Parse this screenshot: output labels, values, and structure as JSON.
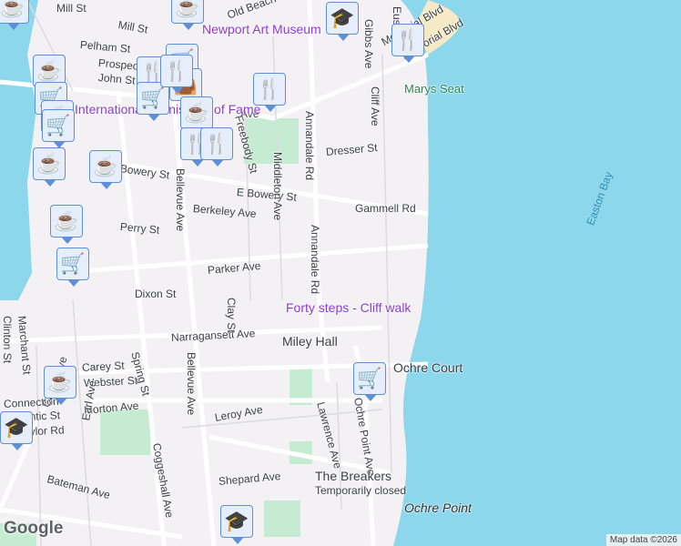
{
  "streets": [
    "Mill St",
    "Mill St",
    "Old Beach",
    "Pelham St",
    "Prospect",
    "John St",
    "Bowery St",
    "E Bowery St",
    "Berkeley Ave",
    "Perry St",
    "Gammell Rd",
    "Dresser St",
    "Parker Ave",
    "Dixon St",
    "Narragansett Ave",
    "Carey St",
    "Webster St",
    "Connection",
    "Atlantic St",
    "Taylor Rd",
    "Morton Ave",
    "Leroy Ave",
    "Bateman Ave",
    "Shepard Ave",
    "Annandale Rd",
    "Annandale Rd",
    "Middleton Ave",
    "Freebody St",
    "Bellevue Ave",
    "Bellevue Ave",
    "Spring St",
    "Coggeshall Ave",
    "Clay St",
    "Lawrence Ave",
    "Ochre Point Ave",
    "Carroll Ave",
    "Earl Ave",
    "Clinton St",
    "Marchant St",
    "Cliff Ave",
    "Gibbs Ave",
    "Memorial Blvd",
    "Eustis",
    "Ave",
    "Memorial Blvd"
  ],
  "pois": {
    "art_museum": "Newport Art Museum",
    "hall_of_fame": "International Tennis Hall of Fame",
    "forty_steps": "Forty steps - Cliff walk",
    "miley_hall": "Miley Hall",
    "ochre_court": "Ochre Court",
    "breakers": "The Breakers",
    "breakers_status": "Temporarily closed"
  },
  "places": {
    "marys_seat": "Marys Seat",
    "easton_bay": "Easton Bay",
    "ochre_point": "Ochre Point"
  },
  "markers": [
    "cafe",
    "cart",
    "cafe",
    "cart",
    "restaurant",
    "cart",
    "cart",
    "shop",
    "restaurant",
    "restaurant",
    "cafe",
    "restaurant",
    "restaurant",
    "cafe",
    "cafe",
    "cafe",
    "cart",
    "cart",
    "cafe",
    "school",
    "school",
    "restaurant",
    "school",
    "cafe",
    "cafe"
  ],
  "icons": {
    "cafe": "☕",
    "cart": "🛒",
    "restaurant": "🍴",
    "shop": "👜",
    "school": "🎓"
  },
  "colors": {
    "water": "#8dd7ec",
    "land": "#f3f1f3",
    "park": "#c5ecd3",
    "marker_bg": "#e6eefc",
    "marker_border": "#5f8fd8"
  },
  "branding": {
    "logo": "Google",
    "attribution": "Map data ©2026"
  }
}
